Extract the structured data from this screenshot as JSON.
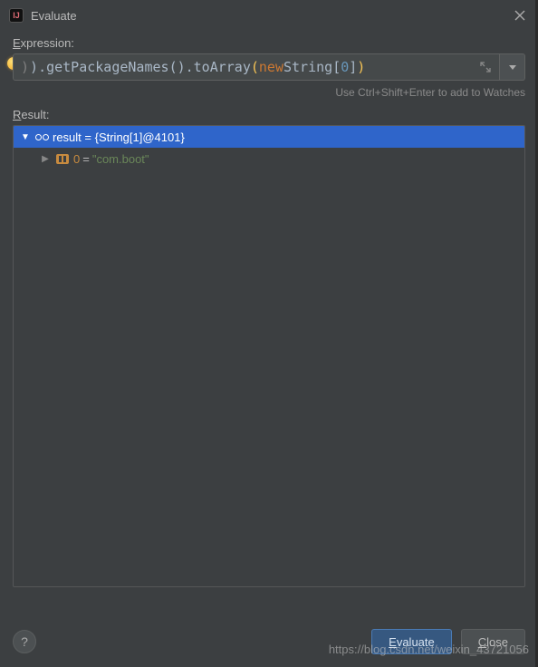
{
  "window": {
    "title": "Evaluate"
  },
  "labels": {
    "expression_prefix": "E",
    "expression_rest": "xpression:",
    "result_prefix": "R",
    "result_rest": "esult:",
    "hint": "Use Ctrl+Shift+Enter to add to Watches"
  },
  "expression": {
    "prefix_char": ")",
    "code": ")).getPackageNames().toArray(new String[0])",
    "tokens": {
      "closep1": ")",
      "closep2": ")",
      "dot1": ".",
      "m1": "getPackageNames",
      "paren1o": "(",
      "paren1c": ")",
      "dot2": ".",
      "m2": "toArray",
      "paren2o": "(",
      "kw": "new",
      "sp": " ",
      "type": "String",
      "brko": "[",
      "num": "0",
      "brkc": "]",
      "paren2c": ")"
    }
  },
  "result": {
    "root": "result = {String[1]@4101}",
    "children": [
      {
        "index": "0",
        "eq": " = ",
        "value": "\"com.boot\""
      }
    ]
  },
  "buttons": {
    "evaluate_prefix": "E",
    "evaluate_rest": "valuate",
    "close_prefix": "C",
    "close_rest": "lose"
  },
  "watermark": "https://blog.csdn.net/weixin_43721056"
}
